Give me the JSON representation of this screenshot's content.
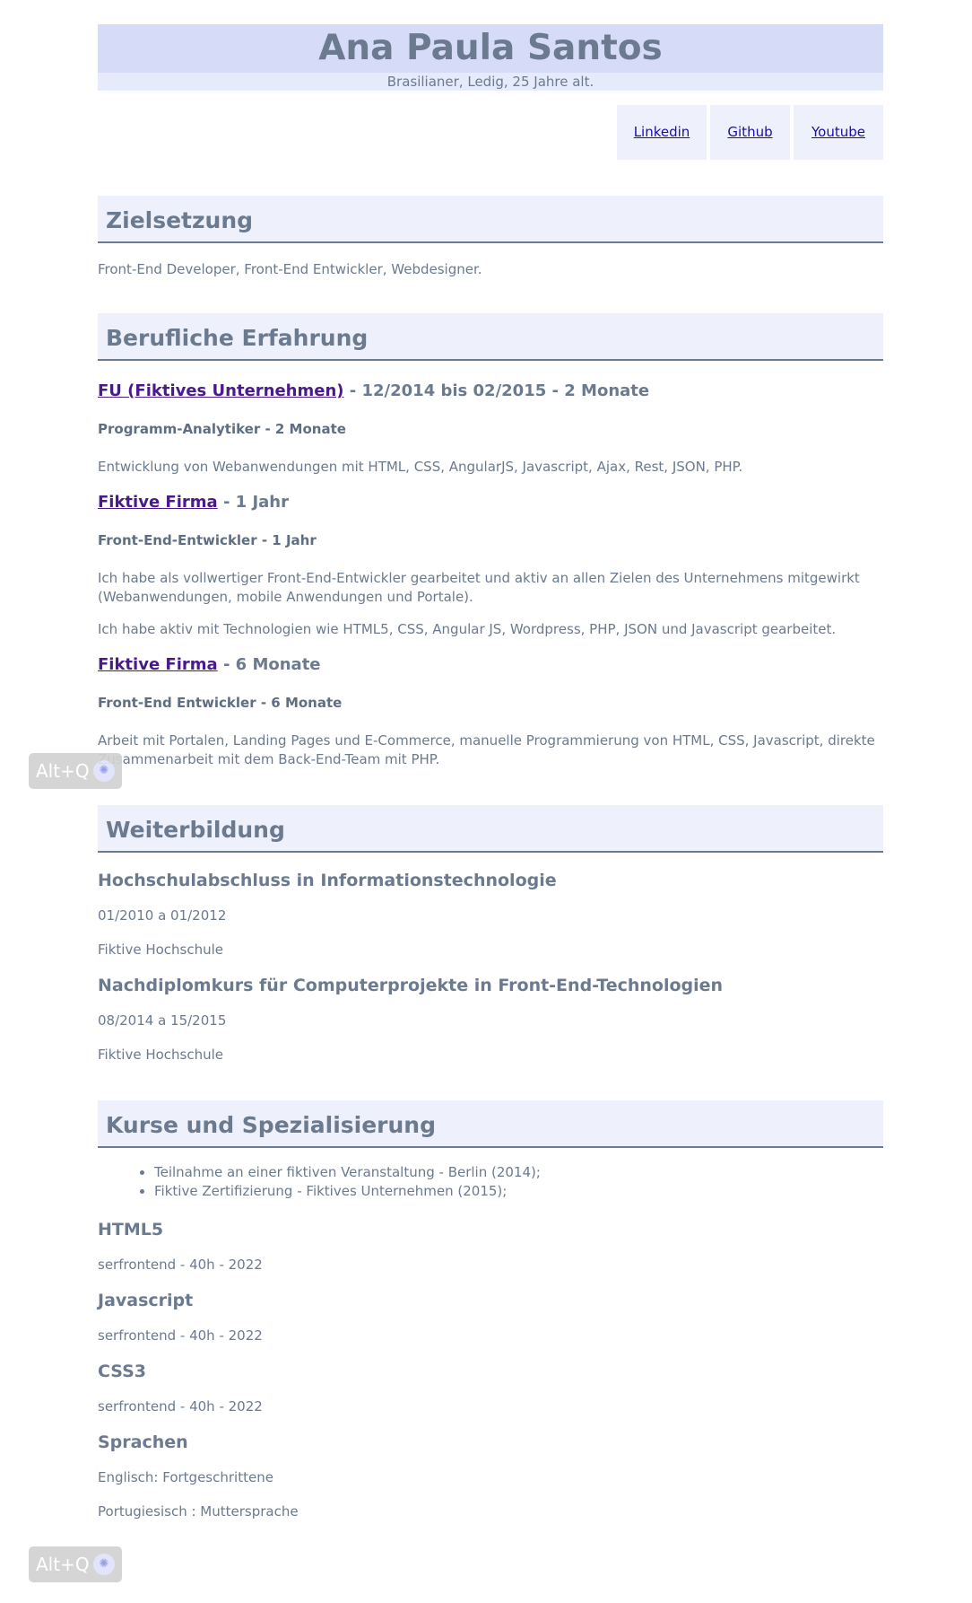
{
  "header": {
    "name": "Ana Paula Santos",
    "subtitle": "Brasilianer, Ledig, 25 Jahre alt."
  },
  "links": [
    {
      "label": "Linkedin"
    },
    {
      "label": "Github"
    },
    {
      "label": "Youtube"
    }
  ],
  "objective": {
    "heading": "Zielsetzung",
    "text": "Front-End Developer, Front-End Entwickler, Webdesigner."
  },
  "experience": {
    "heading": "Berufliche Erfahrung",
    "jobs": [
      {
        "company": "FU (Fiktives Unternehmen)",
        "period": " - 12/2014 bis 02/2015 - 2 Monate",
        "role": "Programm-Analytiker - 2 Monate",
        "descriptions": [
          "Entwicklung von Webanwendungen mit HTML, CSS, AngularJS, Javascript, Ajax, Rest, JSON, PHP."
        ]
      },
      {
        "company": "Fiktive Firma",
        "period": " - 1 Jahr",
        "role": "Front-End-Entwickler - 1 Jahr",
        "descriptions": [
          "Ich habe als vollwertiger Front-End-Entwickler gearbeitet und aktiv an allen Zielen des Unternehmens mitgewirkt (Webanwendungen, mobile Anwendungen und Portale).",
          "Ich habe aktiv mit Technologien wie HTML5, CSS, Angular JS, Wordpress, PHP, JSON und Javascript gearbeitet."
        ]
      },
      {
        "company": "Fiktive Firma",
        "period": " - 6 Monate",
        "role": "Front-End Entwickler - 6 Monate",
        "descriptions": [
          "Arbeit mit Portalen, Landing Pages und E-Commerce, manuelle Programmierung von HTML, CSS, Javascript, direkte Zusammenarbeit mit dem Back-End-Team mit PHP."
        ]
      }
    ]
  },
  "education": {
    "heading": "Weiterbildung",
    "items": [
      {
        "title": "Hochschulabschluss in Informationstechnologie",
        "period": "01/2010 a 01/2012",
        "school": "Fiktive Hochschule"
      },
      {
        "title": "Nachdiplomkurs für Computerprojekte in Front-End-Technologien",
        "period": "08/2014 a 15/2015",
        "school": "Fiktive Hochschule"
      }
    ]
  },
  "courses": {
    "heading": "Kurse und Spezialisierung",
    "bullets": [
      "Teilnahme an einer fiktiven Veranstaltung - Berlin (2014);",
      "Fiktive Zertifizierung - Fiktives Unternehmen (2015);"
    ],
    "items": [
      {
        "title": "HTML5",
        "detail": "serfrontend - 40h - 2022"
      },
      {
        "title": "Javascript",
        "detail": "serfrontend - 40h - 2022"
      },
      {
        "title": "CSS3",
        "detail": "serfrontend - 40h - 2022"
      }
    ],
    "languages_title": "Sprachen",
    "languages": [
      "Englisch: Fortgeschrittene",
      "Portugiesisch : Muttersprache"
    ]
  },
  "overlay": {
    "shortcut_label": "Alt+Q"
  }
}
